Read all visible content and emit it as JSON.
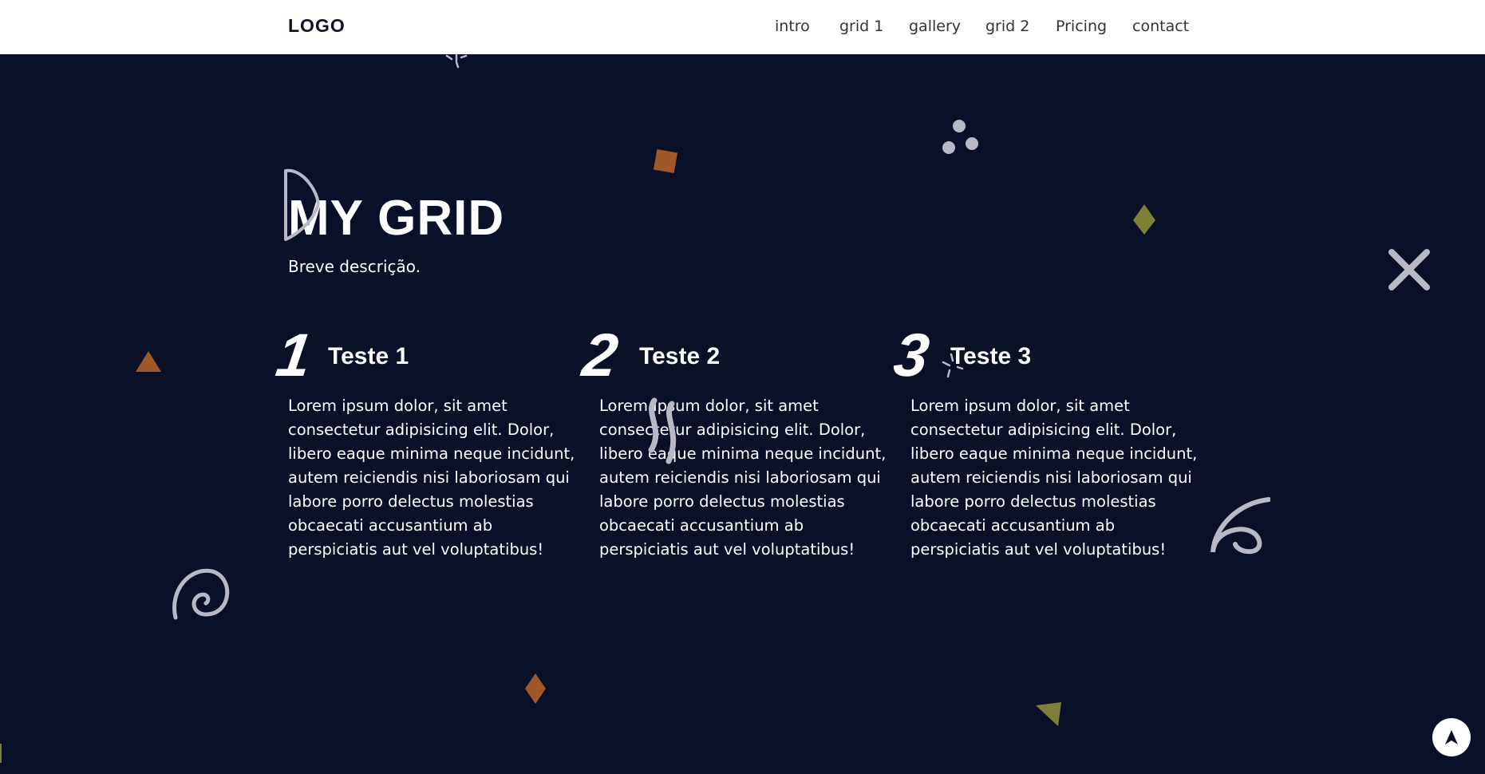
{
  "nav": {
    "logo": "LOGO",
    "links": [
      "intro",
      "grid 1",
      "gallery",
      "grid 2",
      "Pricing",
      "contact"
    ]
  },
  "hero": {
    "title": "MY GRID",
    "subtitle": "Breve descrição."
  },
  "columns": [
    {
      "number": "1",
      "title": "Teste 1",
      "text": "Lorem ipsum dolor, sit amet consectetur adipisicing elit. Dolor, libero eaque minima neque incidunt, autem reiciendis nisi laboriosam qui labore porro delectus molestias obcaecati accusantium ab perspiciatis aut vel voluptatibus!"
    },
    {
      "number": "2",
      "title": "Teste 2",
      "text": "Lorem ipsum dolor, sit amet consectetur adipisicing elit. Dolor, libero eaque minima neque incidunt, autem reiciendis nisi laboriosam qui labore porro delectus molestias obcaecati accusantium ab perspiciatis aut vel voluptatibus!"
    },
    {
      "number": "3",
      "title": "Teste 3",
      "text": "Lorem ipsum dolor, sit amet consectetur adipisicing elit. Dolor, libero eaque minima neque incidunt, autem reiciendis nisi laboriosam qui labore porro delectus molestias obcaecati accusantium ab perspiciatis aut vel voluptatibus!"
    }
  ],
  "colors": {
    "background": "#0b1029",
    "navbar": "#ffffff",
    "accent_orange": "#a0582a",
    "accent_olive": "#7f7f35",
    "decor_grey": "#b9b9c6"
  },
  "scroll_button": {
    "icon": "arrow-up-icon"
  }
}
